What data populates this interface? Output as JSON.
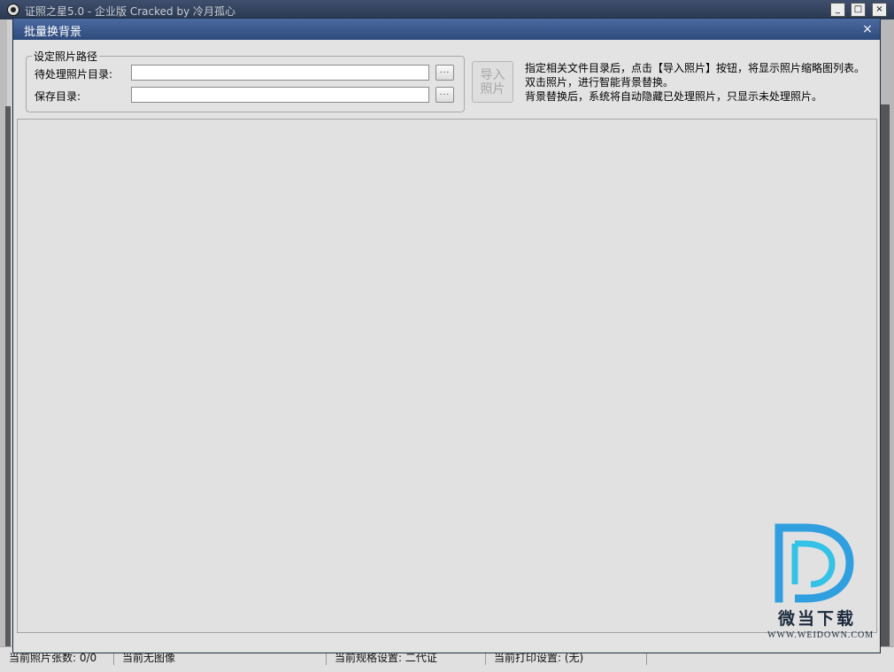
{
  "parent_window": {
    "title": "证照之星5.0 - 企业版 Cracked by 冷月孤心",
    "controls": {
      "minimize": "_",
      "maximize": "□",
      "close": "×"
    }
  },
  "statusbar": {
    "photo_count": "当前照片张数: 0/0",
    "image_status": "当前无图像",
    "spec_setting": "当前规格设置: 二代证",
    "print_setting": "当前打印设置: (无)"
  },
  "dialog": {
    "title": "批量换背景",
    "close": "×",
    "group_title": "设定照片路径",
    "source_label": "待处理照片目录:",
    "source_value": "",
    "save_label": "保存目录:",
    "save_value": "",
    "browse_label": "...",
    "import_button": {
      "line1": "导入",
      "line2": "照片",
      "enabled": false
    },
    "instructions": [
      "指定相关文件目录后，点击【导入照片】按钮，将显示照片缩略图列表。",
      "双击照片，进行智能背景替换。",
      "背景替换后，系统将自动隐藏已处理照片，只显示未处理照片。"
    ]
  },
  "watermark": {
    "brand_cn": "微当下载",
    "brand_url": "WWW.WEIDOWN.COM",
    "colors": {
      "logo_blue": "#2f9fe0",
      "logo_cyan": "#34c2e6",
      "text": "#1b2a3c"
    }
  }
}
